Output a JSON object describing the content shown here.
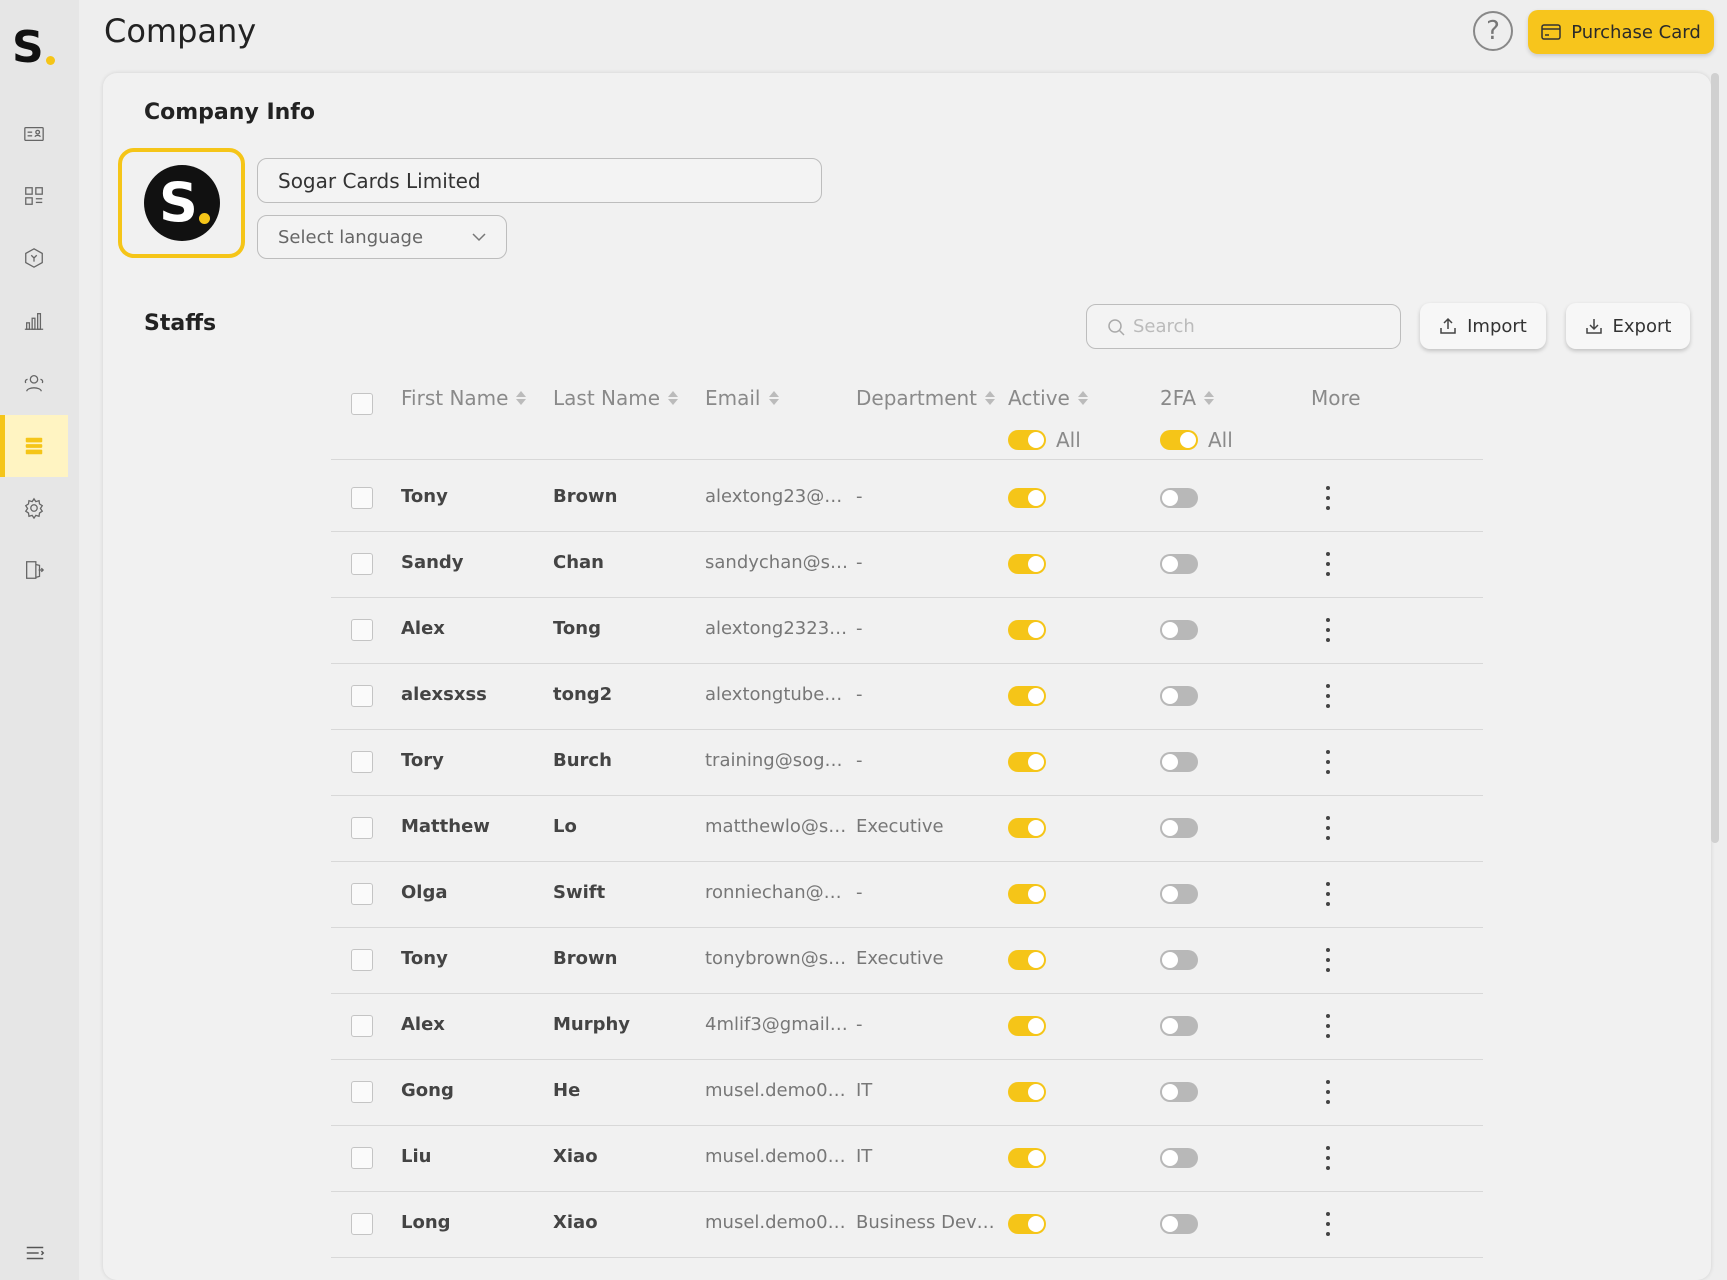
{
  "header": {
    "title": "Company",
    "help_label": "?",
    "purchase_label": "Purchase Card"
  },
  "sidebar": {
    "logo_text": "S",
    "items": [
      {
        "icon": "profile-card-icon"
      },
      {
        "icon": "dashboard-grid-icon"
      },
      {
        "icon": "box-icon"
      },
      {
        "icon": "bar-chart-icon"
      },
      {
        "icon": "users-icon"
      },
      {
        "icon": "company-icon",
        "active": true
      },
      {
        "icon": "gear-icon"
      },
      {
        "icon": "logout-icon"
      }
    ]
  },
  "company_info": {
    "title": "Company Info",
    "logo_text": "S",
    "company_name": "Sogar Cards Limited",
    "language_placeholder": "Select language"
  },
  "staffs": {
    "title": "Staffs",
    "search_placeholder": "Search",
    "import_label": "Import",
    "export_label": "Export",
    "columns": {
      "first_name": "First Name",
      "last_name": "Last Name",
      "email": "Email",
      "department": "Department",
      "active": "Active",
      "twofa": "2FA",
      "more": "More"
    },
    "filters": {
      "active_all": "All",
      "twofa_all": "All"
    },
    "rows": [
      {
        "first": "Tony",
        "last": "Brown",
        "email": "alextong23@…",
        "dept": "-",
        "active": true,
        "twofa": false
      },
      {
        "first": "Sandy",
        "last": "Chan",
        "email": "sandychan@s…",
        "dept": "-",
        "active": true,
        "twofa": false
      },
      {
        "first": "Alex",
        "last": "Tong",
        "email": "alextong2323…",
        "dept": "-",
        "active": true,
        "twofa": false
      },
      {
        "first": "alexsxss",
        "last": "tong2",
        "email": "alextongtube…",
        "dept": "-",
        "active": true,
        "twofa": false
      },
      {
        "first": "Tory",
        "last": "Burch",
        "email": "training@sog…",
        "dept": "-",
        "active": true,
        "twofa": false
      },
      {
        "first": "Matthew",
        "last": "Lo",
        "email": "matthewlo@s…",
        "dept": "Executive",
        "active": true,
        "twofa": false
      },
      {
        "first": "Olga",
        "last": "Swift",
        "email": "ronniechan@…",
        "dept": "-",
        "active": true,
        "twofa": false
      },
      {
        "first": "Tony",
        "last": "Brown",
        "email": "tonybrown@s…",
        "dept": "Executive",
        "active": true,
        "twofa": false
      },
      {
        "first": "Alex",
        "last": "Murphy",
        "email": "4mlif3@gmail…",
        "dept": "-",
        "active": true,
        "twofa": false
      },
      {
        "first": "Gong",
        "last": "He",
        "email": "musel.demo0…",
        "dept": "IT",
        "active": true,
        "twofa": false
      },
      {
        "first": "Liu",
        "last": "Xiao",
        "email": "musel.demo0…",
        "dept": "IT",
        "active": true,
        "twofa": false
      },
      {
        "first": "Long",
        "last": "Xiao",
        "email": "musel.demo0…",
        "dept": "Business Dev…",
        "active": true,
        "twofa": false
      }
    ]
  },
  "colors": {
    "accent": "#f5c518",
    "background": "#eeeeee",
    "card": "#f1f1f1"
  }
}
